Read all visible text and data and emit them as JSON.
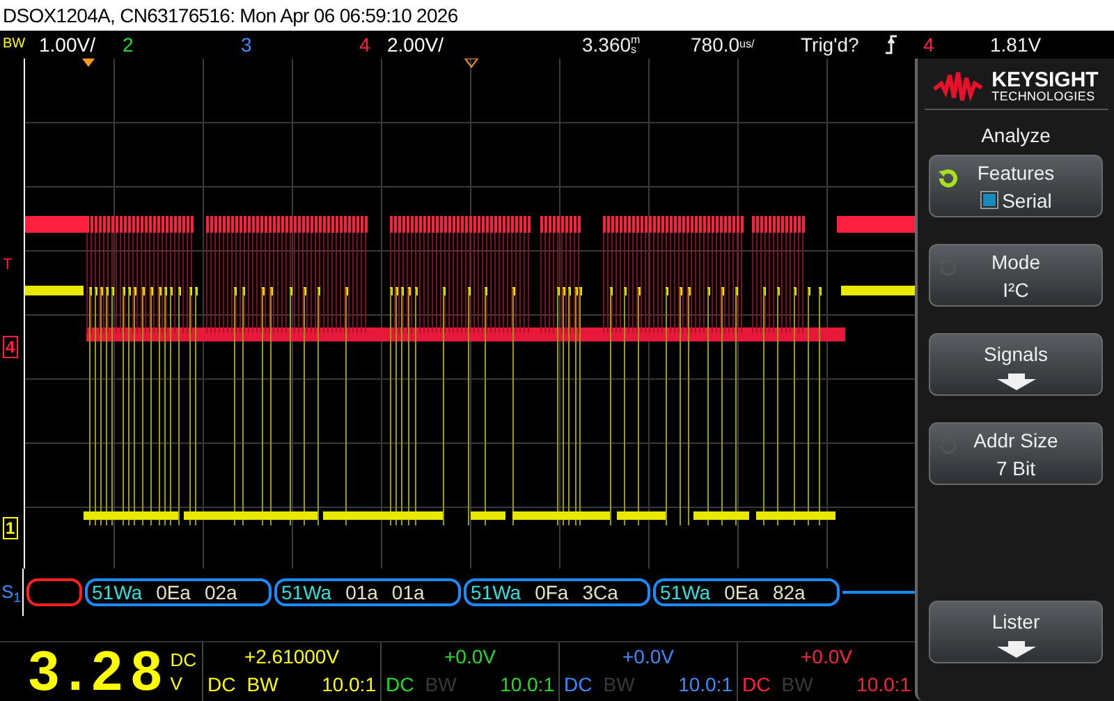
{
  "window": {
    "title": "DSOX1204A, CN63176516: Mon Apr 06 06:59:10 2026"
  },
  "status_bar": {
    "bw": "BW",
    "channels": [
      {
        "label": "1.00V/",
        "color": "#ffffff"
      },
      {
        "label": "2",
        "color": "#22dd22"
      },
      {
        "label": "3",
        "color": "#3b8bff"
      },
      {
        "label": "4",
        "color": "#ff2040"
      },
      {
        "label": "2.00V/",
        "color": "#ffffff"
      }
    ],
    "time_delay": "3.360",
    "time_delay_unit": "ms",
    "time_scale": "780.0",
    "time_scale_unit": "us/",
    "trigger_state": "Trig'd?",
    "trigger_source": "4",
    "trigger_level": "1.81V"
  },
  "scope": {
    "markers": [
      {
        "label": "T",
        "kind": "trigger",
        "color": "#ff2040"
      },
      {
        "label": "4",
        "kind": "channel",
        "color": "#ff2040"
      },
      {
        "label": "1",
        "kind": "channel",
        "color": "#ffff00"
      }
    ]
  },
  "decode": {
    "label": "S",
    "index": "1",
    "packets": [
      {
        "kind": "error"
      },
      {
        "kind": "packet",
        "address": "51Wa",
        "data": [
          "0Ea",
          "02a"
        ]
      },
      {
        "kind": "packet",
        "address": "51Wa",
        "data": [
          "01a",
          "01a"
        ]
      },
      {
        "kind": "packet",
        "address": "51Wa",
        "data": [
          "0Fa",
          "3Ca"
        ]
      },
      {
        "kind": "packet",
        "address": "51Wa",
        "data": [
          "0Ea",
          "82a"
        ]
      }
    ]
  },
  "measurement": {
    "value": "3.28",
    "coupling": "DC",
    "unit": "V"
  },
  "channel_info": [
    {
      "offset": "+2.61000V",
      "coupling": "DC",
      "bw": "BW",
      "bw_on": true,
      "probe": "10.0:1",
      "color": "#ffff00"
    },
    {
      "offset": "+0.0V",
      "coupling": "DC",
      "bw": "BW",
      "bw_on": false,
      "probe": "10.0:1",
      "color": "#22dd22"
    },
    {
      "offset": "+0.0V",
      "coupling": "DC",
      "bw": "BW",
      "bw_on": false,
      "probe": "10.0:1",
      "color": "#3b8bff"
    },
    {
      "offset": "+0.0V",
      "coupling": "DC",
      "bw": "BW",
      "bw_on": false,
      "probe": "10.0:1",
      "color": "#ff2040"
    }
  ],
  "softkeys": {
    "brand": "KEYSIGHT",
    "brand_sub": "TECHNOLOGIES",
    "menu_title": "Analyze",
    "buttons": [
      {
        "kind": "check",
        "label": "Features",
        "value": "Serial",
        "knob_active": true,
        "checked": true
      },
      {
        "kind": "value",
        "label": "Mode",
        "value": "I²C",
        "knob_active": false
      },
      {
        "kind": "submenu",
        "label": "Signals"
      },
      {
        "kind": "value",
        "label": "Addr Size",
        "value": "7 Bit",
        "knob_active": false
      },
      {
        "kind": "spacer"
      },
      {
        "kind": "submenu",
        "label": "Lister"
      }
    ]
  }
}
